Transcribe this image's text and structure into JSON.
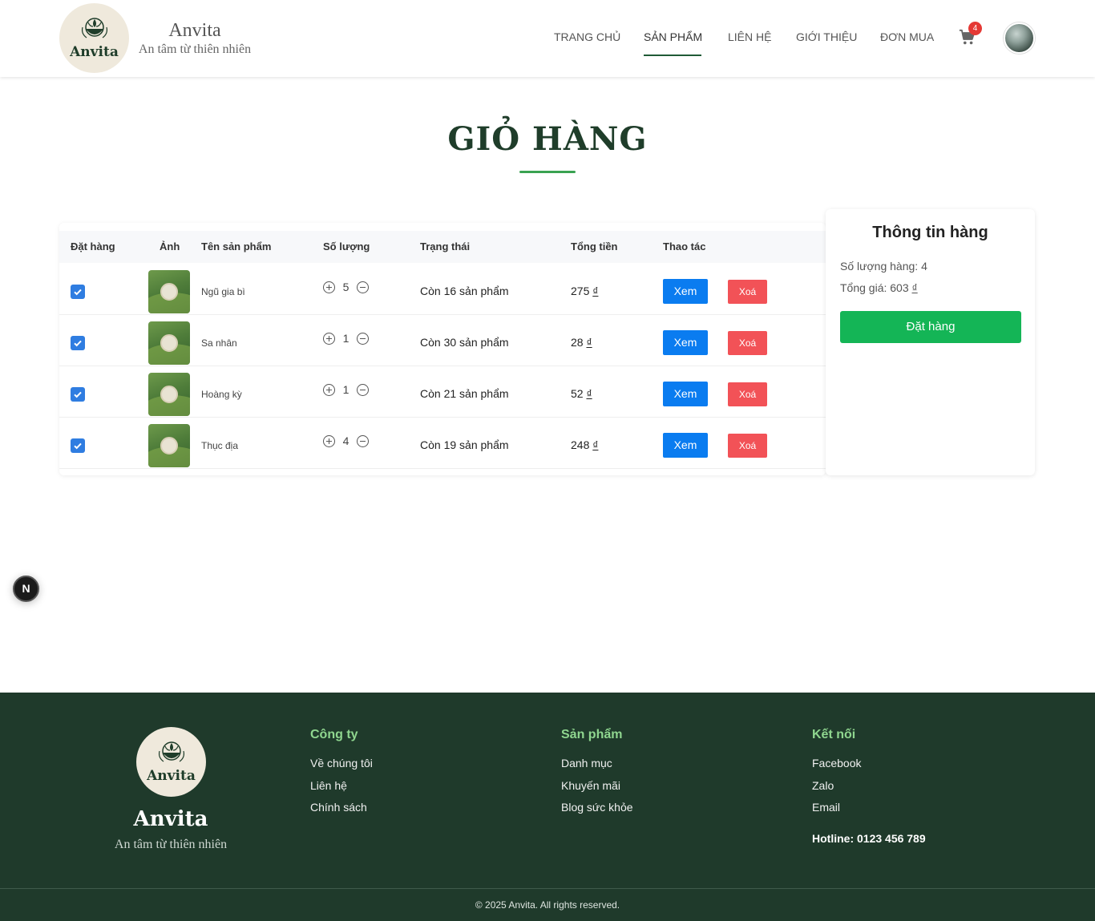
{
  "header": {
    "logo_text": "Anvita",
    "brand_name": "Anvita",
    "brand_tagline": "An tâm từ thiên nhiên",
    "nav": [
      {
        "label": "TRANG CHỦ"
      },
      {
        "label": "SẢN PHẨM"
      },
      {
        "label": "LIÊN HỆ"
      },
      {
        "label": "GIỚI THIỆU"
      },
      {
        "label": "ĐƠN MUA"
      }
    ],
    "active_nav": "SẢN PHẨM",
    "cart_count": "4",
    "cart_icon": "shopping-cart-icon"
  },
  "page": {
    "title": "GIỎ HÀNG"
  },
  "table": {
    "columns": [
      "Đặt hàng",
      "Ảnh",
      "Tên sản phẩm",
      "Số lượng",
      "Trạng thái",
      "Tổng tiền",
      "Thao tác"
    ],
    "rows": [
      {
        "checked": true,
        "name": "Ngũ gia bì",
        "qty": "5",
        "status": "Còn 16 sản phẩm",
        "total": "275",
        "currency": "₫",
        "view": "Xem",
        "delete": "Xoá"
      },
      {
        "checked": true,
        "name": "Sa nhân",
        "qty": "1",
        "status": "Còn 30 sản phẩm",
        "total": "28",
        "currency": "₫",
        "view": "Xem",
        "delete": "Xoá"
      },
      {
        "checked": true,
        "name": "Hoàng kỳ",
        "qty": "1",
        "status": "Còn 21 sản phẩm",
        "total": "52",
        "currency": "₫",
        "view": "Xem",
        "delete": "Xoá"
      },
      {
        "checked": true,
        "name": "Thục địa",
        "qty": "4",
        "status": "Còn 19 sản phẩm",
        "total": "248",
        "currency": "₫",
        "view": "Xem",
        "delete": "Xoá"
      }
    ]
  },
  "summary": {
    "title": "Thông tin hàng",
    "count_label": "Số lượng hàng: 4",
    "total_label": "Tổng giá: 603",
    "currency": "₫",
    "order_button": "Đặt hàng"
  },
  "dev_badge": "N",
  "footer": {
    "logo_text": "Anvita",
    "brand_name": "Anvita",
    "tagline": "An tâm từ thiên nhiên",
    "company": {
      "heading": "Công ty",
      "links": [
        "Về chúng tôi",
        "Liên hệ",
        "Chính sách"
      ]
    },
    "products": {
      "heading": "Sản phẩm",
      "links": [
        "Danh mục",
        "Khuyến mãi",
        "Blog sức khỏe"
      ]
    },
    "connect": {
      "heading": "Kết nối",
      "links": [
        "Facebook",
        "Zalo",
        "Email"
      ]
    },
    "hotline": "Hotline: 0123 456 789",
    "copyright": "© 2025 Anvita. All rights reserved."
  },
  "colors": {
    "brand_dark": "#1f3d2a",
    "footer_bg": "#1f3a2b",
    "accent_green": "#3aa251",
    "order_button": "#14b556",
    "view_button": "#0a7cf0",
    "delete_button": "#f25257",
    "badge_red": "#e53935"
  }
}
